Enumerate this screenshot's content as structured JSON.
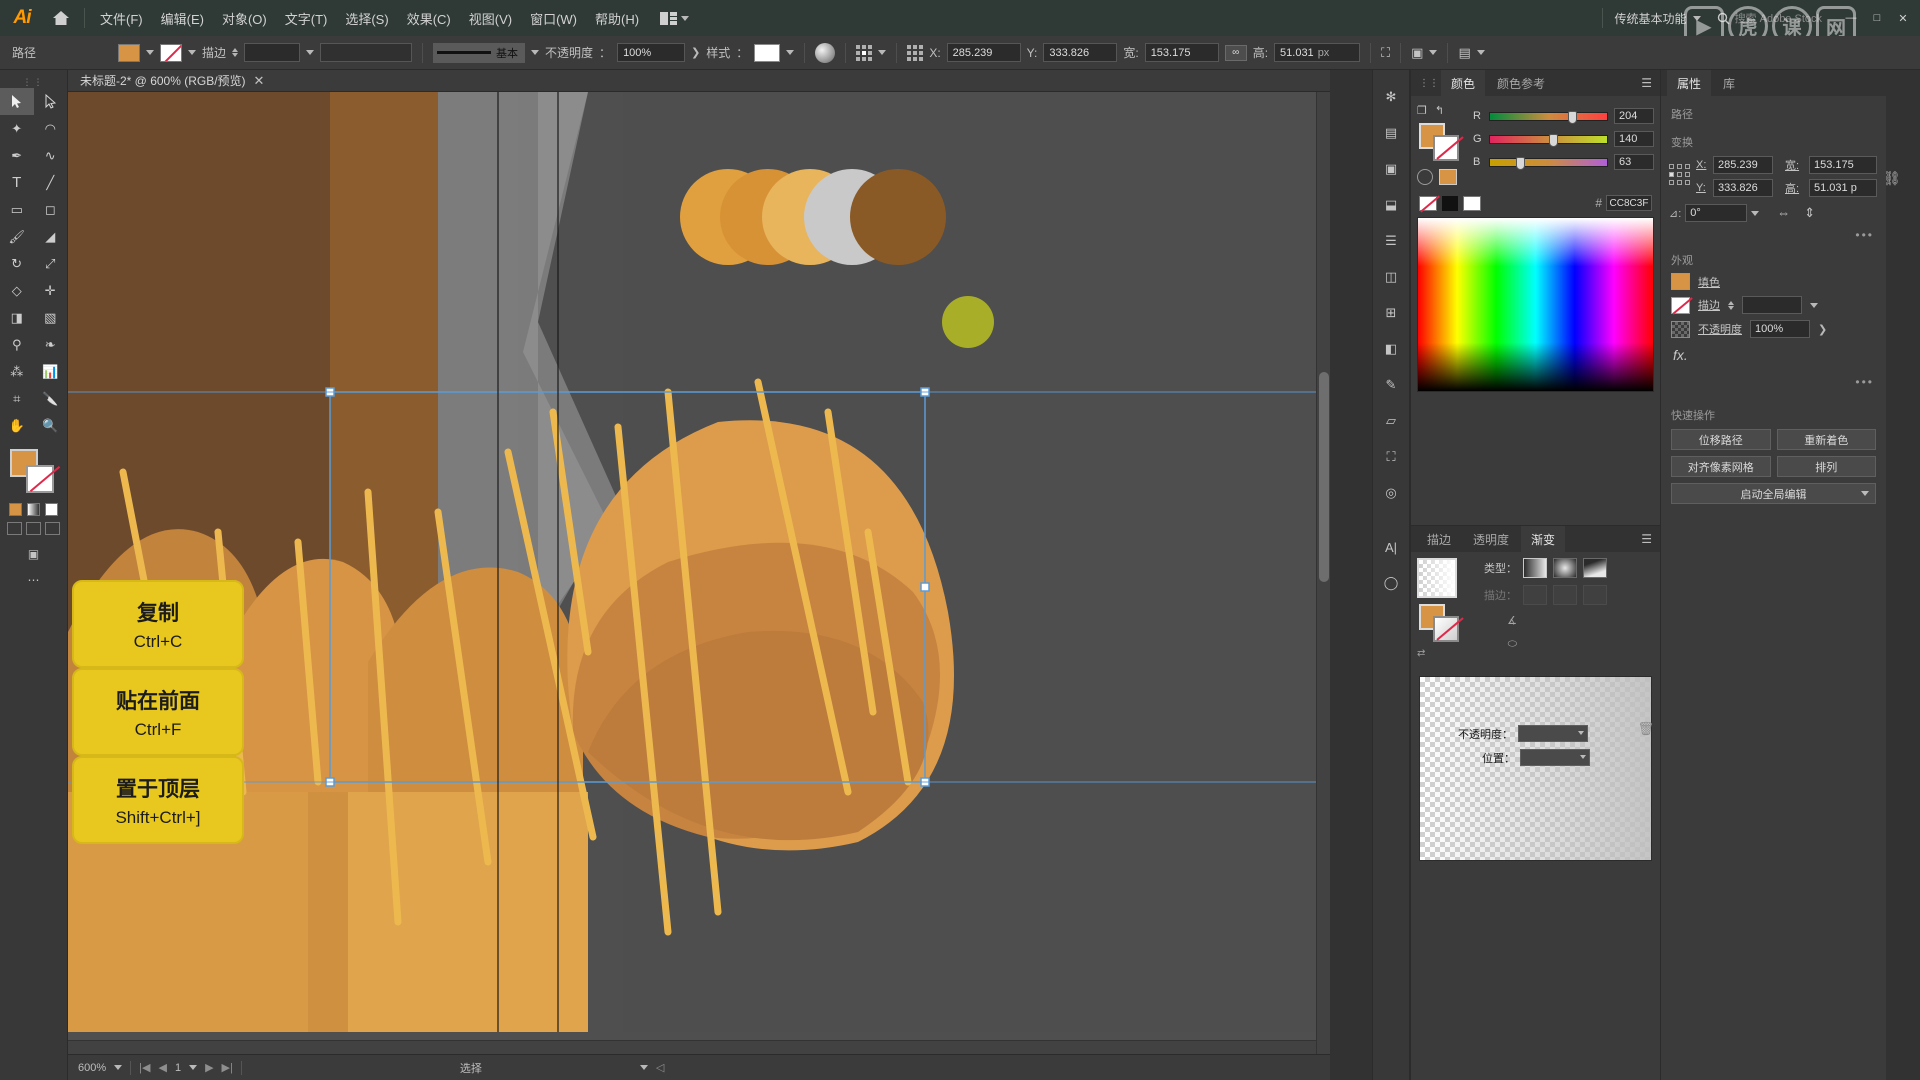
{
  "app": {
    "name": "Ai",
    "logo_color": "#ff9a00"
  },
  "menubar": {
    "items": [
      {
        "label": "文件(F)"
      },
      {
        "label": "编辑(E)"
      },
      {
        "label": "对象(O)"
      },
      {
        "label": "文字(T)"
      },
      {
        "label": "选择(S)"
      },
      {
        "label": "效果(C)"
      },
      {
        "label": "视图(V)"
      },
      {
        "label": "窗口(W)"
      },
      {
        "label": "帮助(H)"
      }
    ],
    "workspace": "传统基本功能",
    "search_placeholder": "搜索 Adobe Stock",
    "min": "—",
    "max": "□",
    "close": "✕"
  },
  "optionsbar": {
    "path_label": "路径",
    "fill_color": "#d79445",
    "stroke_label": "描边",
    "stroke_weight": "",
    "brush_label": "基本",
    "opacity_label": "不透明度",
    "opacity_value": "100%",
    "style_label": "样式",
    "x_label": "X:",
    "x_value": "285.239",
    "y_label": "Y:",
    "y_value": "333.826",
    "w_label": "宽:",
    "w_value": "153.175",
    "h_label": "高:",
    "h_value": "51.031",
    "h_unit": "px"
  },
  "document": {
    "tab_title": "未标题-2* @ 600% (RGB/预览)",
    "close": "✕"
  },
  "statusbar": {
    "zoom": "600%",
    "page": "1",
    "tool": "选择"
  },
  "canvas": {
    "tooltips": [
      {
        "title": "复制",
        "key": "Ctrl+C"
      },
      {
        "title": "贴在前面",
        "key": "Ctrl+F"
      },
      {
        "title": "置于顶层",
        "key": "Shift+Ctrl+]"
      }
    ],
    "tooltip_bg": "#e8c81e"
  },
  "color_panel": {
    "tabs": [
      {
        "label": "颜色",
        "active": true
      },
      {
        "label": "颜色参考",
        "active": false
      }
    ],
    "channels": [
      {
        "label": "R",
        "value": "204"
      },
      {
        "label": "G",
        "value": "140"
      },
      {
        "label": "B",
        "value": "63"
      }
    ],
    "hex_prefix": "#",
    "hex": "CC8C3F",
    "fill_color": "#cc8c3f"
  },
  "gradient_panel": {
    "tabs": [
      {
        "label": "描边",
        "active": false
      },
      {
        "label": "透明度",
        "active": false
      },
      {
        "label": "渐变",
        "active": true
      }
    ],
    "type_label": "类型：",
    "stroke_label": "描边：",
    "angle_label": "",
    "opacity_label": "不透明度：",
    "position_label": "位置："
  },
  "properties": {
    "tabs": [
      {
        "label": "属性",
        "active": true
      },
      {
        "label": "库",
        "active": false
      }
    ],
    "object_type": "路径",
    "transform_title": "变换",
    "x_label": "X:",
    "x_value": "285.239",
    "y_label": "Y:",
    "y_value": "333.826",
    "w_label": "宽:",
    "w_value": "153.175",
    "h_label": "高:",
    "h_value": "51.031 p",
    "angle_value": "0°",
    "appearance_title": "外观",
    "fill_label": "填色",
    "stroke_label": "描边",
    "opacity_label": "不透明度",
    "opacity_value": "100%",
    "fx_label": "fx.",
    "quick_actions_title": "快速操作",
    "quick_actions": [
      {
        "label": "位移路径"
      },
      {
        "label": "重新着色"
      },
      {
        "label": "对齐像素网格"
      },
      {
        "label": "排列"
      },
      {
        "label": "启动全局编辑"
      }
    ]
  },
  "toolbar": {
    "tools": [
      "selection-tool",
      "direct-selection-tool",
      "magic-wand-tool",
      "lasso-tool",
      "pen-tool",
      "curvature-tool",
      "type-tool",
      "line-tool",
      "rectangle-tool",
      "ellipse-tool",
      "paintbrush-tool",
      "shaper-tool",
      "rotate-tool",
      "scale-tool",
      "width-tool",
      "free-transform-tool",
      "shape-builder-tool",
      "gradient-tool",
      "eyedropper-tool",
      "blend-tool",
      "symbol-sprayer-tool",
      "column-graph-tool",
      "artboard-tool",
      "slice-tool",
      "hand-tool",
      "zoom-tool"
    ]
  },
  "mini_dock": {
    "items": [
      "brush-libraries-icon",
      "layers-icon",
      "artboards-icon",
      "asset-export-icon",
      "align-icon",
      "pathfinder-icon",
      "transform-icon",
      "image-trace-icon",
      "document-info-icon",
      "navigator-icon",
      "links-icon",
      "appearance-icon",
      "character-icon",
      "symbols-icon"
    ]
  },
  "watermark": {
    "text1": "虎",
    "text2": "课",
    "text3": "网"
  }
}
